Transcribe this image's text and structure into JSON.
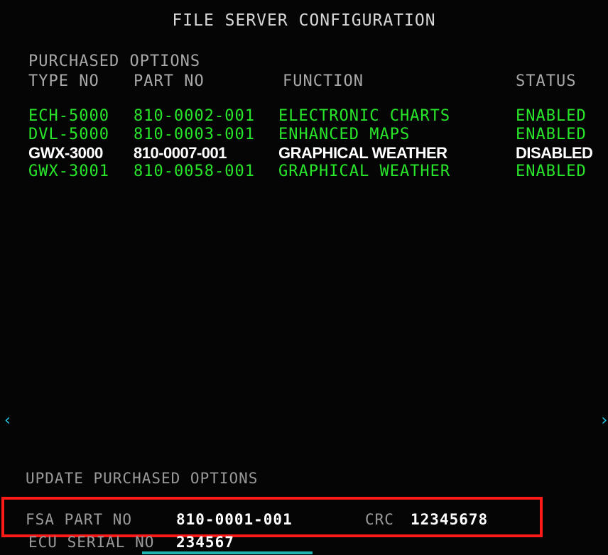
{
  "title": "FILE SERVER CONFIGURATION",
  "headers": {
    "purchased_options": "PURCHASED OPTIONS",
    "type_no": "TYPE NO",
    "part_no": "PART NO",
    "function": "FUNCTION",
    "status": "STATUS"
  },
  "options": [
    {
      "type": "ECH-5000",
      "part": "810-0002-001",
      "function": "ELECTRONIC CHARTS",
      "status": "ENABLED"
    },
    {
      "type": "DVL-5000",
      "part": "810-0003-001",
      "function": "ENHANCED MAPS",
      "status": "ENABLED"
    },
    {
      "type": "GWX-3000",
      "part": "810-0007-001",
      "function": "GRAPHICAL WEATHER",
      "status": "DISABLED"
    },
    {
      "type": "GWX-3001",
      "part": "810-0058-001",
      "function": "GRAPHICAL WEATHER",
      "status": "ENABLED"
    }
  ],
  "nav": {
    "left_arrow": "‹",
    "right_arrow": "›"
  },
  "update_label": "UPDATE PURCHASED OPTIONS",
  "fsa": {
    "label": "FSA PART NO",
    "value": "810-0001-001"
  },
  "crc": {
    "label": "CRC",
    "value": "12345678"
  },
  "ecu": {
    "label": "ECU SERIAL NO",
    "value": "234567"
  },
  "colors": {
    "enabled_text": "#28e62a",
    "selected_text": "#ffffff",
    "highlight_box": "#ff1a1a"
  }
}
